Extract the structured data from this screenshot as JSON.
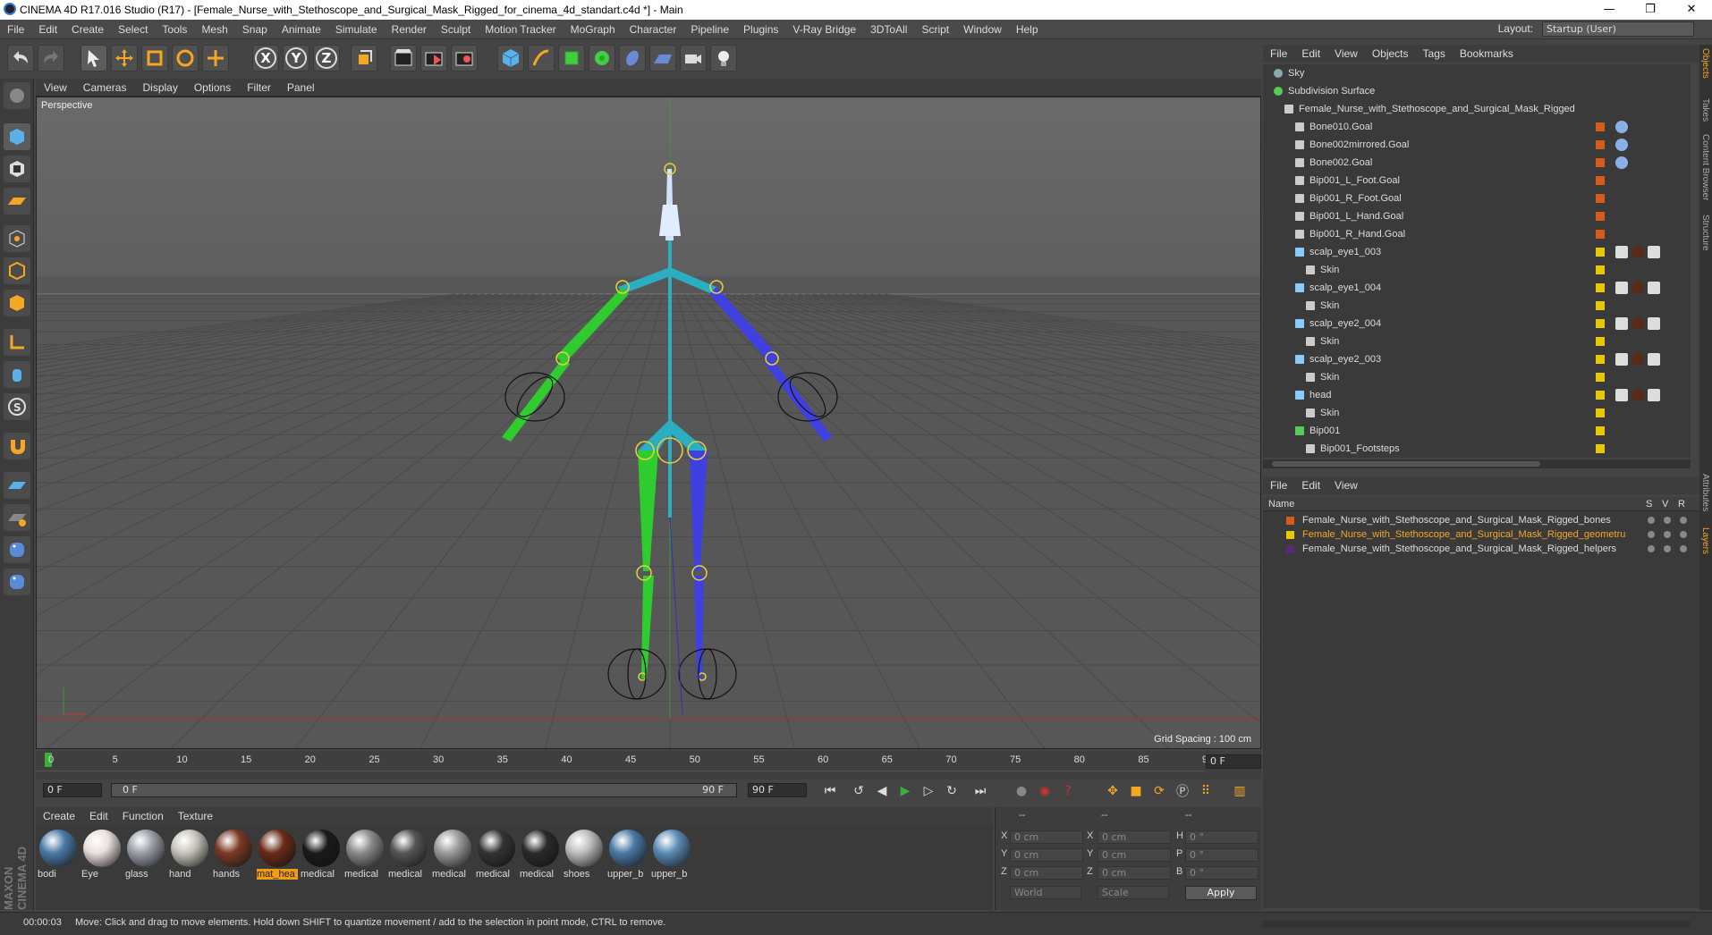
{
  "window": {
    "title": "CINEMA 4D R17.016 Studio (R17) - [Female_Nurse_with_Stethoscope_and_Surgical_Mask_Rigged_for_cinema_4d_standart.c4d *] - Main",
    "minimize": "—",
    "maximize": "❐",
    "close": "✕"
  },
  "menubar": {
    "items": [
      "File",
      "Edit",
      "Create",
      "Select",
      "Tools",
      "Mesh",
      "Snap",
      "Animate",
      "Simulate",
      "Render",
      "Sculpt",
      "Motion Tracker",
      "MoGraph",
      "Character",
      "Pipeline",
      "Plugins",
      "V-Ray Bridge",
      "3DToAll",
      "Script",
      "Window",
      "Help"
    ],
    "layout_label": "Layout:",
    "layout_value": "Startup (User)"
  },
  "toolbar": {
    "x_label": "X",
    "y_label": "Y",
    "z_label": "Z"
  },
  "viewport": {
    "menu": [
      "View",
      "Cameras",
      "Display",
      "Options",
      "Filter",
      "Panel"
    ],
    "label": "Perspective",
    "grid_spacing": "Grid Spacing : 100 cm"
  },
  "timeline": {
    "ticks": [
      "0",
      "5",
      "10",
      "15",
      "20",
      "25",
      "30",
      "35",
      "40",
      "45",
      "50",
      "55",
      "60",
      "65",
      "70",
      "75",
      "80",
      "85",
      "90"
    ],
    "current_frame": "0 F",
    "start_field": "0 F",
    "range_start": "0 F",
    "range_end": "90 F",
    "end_field": "90 F"
  },
  "materials": {
    "menu": [
      "Create",
      "Edit",
      "Function",
      "Texture"
    ],
    "items": [
      {
        "label": "bodi",
        "color": "#4a7aa5"
      },
      {
        "label": "Eye",
        "color": "#e8e0dc"
      },
      {
        "label": "glass",
        "color": "#9aa0a8"
      },
      {
        "label": "hand",
        "color": "#c8c4bc"
      },
      {
        "label": "hands",
        "color": "#7a3a24"
      },
      {
        "label": "mat_hea",
        "color": "#6a2a18"
      },
      {
        "label": "medical",
        "color": "#1a1a1a"
      },
      {
        "label": "medical",
        "color": "#8a8a8a"
      },
      {
        "label": "medical",
        "color": "#555"
      },
      {
        "label": "medical",
        "color": "#9a9a9a"
      },
      {
        "label": "medical",
        "color": "#333"
      },
      {
        "label": "medical",
        "color": "#2a2a2a"
      },
      {
        "label": "shoes",
        "color": "#bcbcbc"
      },
      {
        "label": "upper_b",
        "color": "#4a7aa5"
      },
      {
        "label": "upper_b",
        "color": "#5a8ab5"
      }
    ],
    "selected_index": 5
  },
  "coords": {
    "headers": [
      "--",
      "--",
      "--"
    ],
    "x_label": "X",
    "y_label": "Y",
    "z_label": "Z",
    "h_label": "H",
    "p_label": "P",
    "b_label": "B",
    "pos_x": "0 cm",
    "pos_y": "0 cm",
    "pos_z": "0 cm",
    "size_x": "0 cm",
    "size_y": "0 cm",
    "size_z": "0 cm",
    "rot_h": "0 °",
    "rot_p": "0 °",
    "rot_b": "0 °",
    "mode1": "World",
    "mode2": "Scale",
    "apply": "Apply"
  },
  "status": {
    "time": "00:00:03",
    "message": "Move: Click and drag to move elements. Hold down SHIFT to quantize movement / add to the selection in point mode, CTRL to remove."
  },
  "objects": {
    "menu": [
      "File",
      "Edit",
      "View",
      "Objects",
      "Tags",
      "Bookmarks"
    ],
    "rows": [
      {
        "name": "Sky",
        "indent": 0,
        "color": "#8aa"
      },
      {
        "name": "Subdivision Surface",
        "indent": 0,
        "color": "#5c5"
      },
      {
        "name": "Female_Nurse_with_Stethoscope_and_Surgical_Mask_Rigged",
        "indent": 1,
        "color": "#ccc"
      },
      {
        "name": "Bone010.Goal",
        "indent": 2,
        "color": "#ccc"
      },
      {
        "name": "Bone002mirrored.Goal",
        "indent": 2,
        "color": "#ccc"
      },
      {
        "name": "Bone002.Goal",
        "indent": 2,
        "color": "#ccc"
      },
      {
        "name": "Bip001_L_Foot.Goal",
        "indent": 2,
        "color": "#ccc"
      },
      {
        "name": "Bip001_R_Foot.Goal",
        "indent": 2,
        "color": "#ccc"
      },
      {
        "name": "Bip001_L_Hand.Goal",
        "indent": 2,
        "color": "#ccc"
      },
      {
        "name": "Bip001_R_Hand.Goal",
        "indent": 2,
        "color": "#ccc"
      },
      {
        "name": "scalp_eye1_003",
        "indent": 2,
        "color": "#8cf"
      },
      {
        "name": "Skin",
        "indent": 3,
        "color": "#ccc"
      },
      {
        "name": "scalp_eye1_004",
        "indent": 2,
        "color": "#8cf"
      },
      {
        "name": "Skin",
        "indent": 3,
        "color": "#ccc"
      },
      {
        "name": "scalp_eye2_004",
        "indent": 2,
        "color": "#8cf"
      },
      {
        "name": "Skin",
        "indent": 3,
        "color": "#ccc"
      },
      {
        "name": "scalp_eye2_003",
        "indent": 2,
        "color": "#8cf"
      },
      {
        "name": "Skin",
        "indent": 3,
        "color": "#ccc"
      },
      {
        "name": "head",
        "indent": 2,
        "color": "#8cf"
      },
      {
        "name": "Skin",
        "indent": 3,
        "color": "#ccc"
      },
      {
        "name": "Bip001",
        "indent": 2,
        "color": "#5c5"
      },
      {
        "name": "Bip001_Footsteps",
        "indent": 3,
        "color": "#ccc"
      }
    ]
  },
  "layers": {
    "menu": [
      "File",
      "Edit",
      "View"
    ],
    "columns": {
      "name": "Name",
      "s": "S",
      "v": "V",
      "r": "R"
    },
    "rows": [
      {
        "name": "Female_Nurse_with_Stethoscope_and_Surgical_Mask_Rigged_bones",
        "color": "#d85a1a",
        "highlight": false
      },
      {
        "name": "Female_Nurse_with_Stethoscope_and_Surgical_Mask_Rigged_geometru",
        "color": "#e8c800",
        "highlight": true
      },
      {
        "name": "Female_Nurse_with_Stethoscope_and_Surgical_Mask_Rigged_helpers",
        "color": "#5a2a7a",
        "highlight": false
      }
    ]
  },
  "right_tabs": [
    "Objects",
    "Takes",
    "Content Browser",
    "Structure",
    "Attributes",
    "Layers"
  ],
  "side_logo": "MAXON CINEMA 4D"
}
